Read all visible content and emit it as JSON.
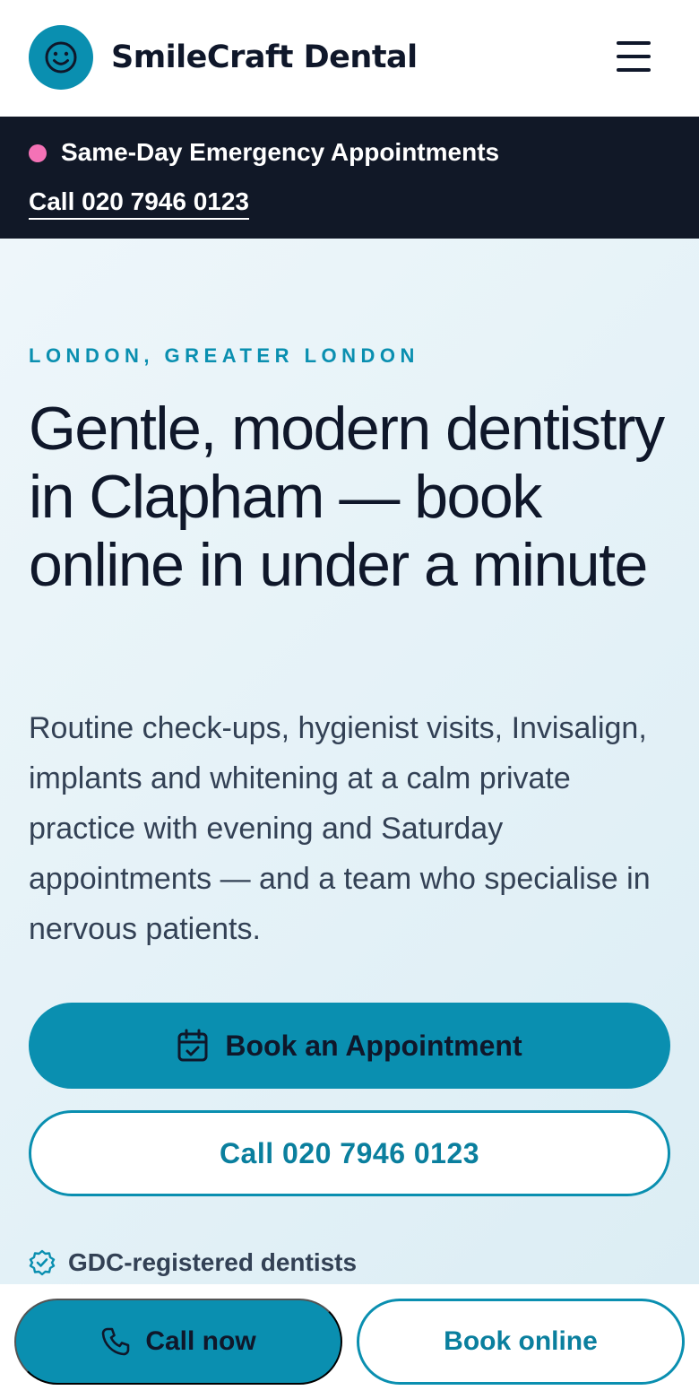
{
  "header": {
    "brand": "SmileCraft Dental",
    "logo_icon": "smiley-face-icon",
    "menu_icon": "hamburger-menu-icon"
  },
  "banner": {
    "title": "Same-Day Emergency Appointments",
    "phone_link": "Call 020 7946 0123",
    "dot_color": "#f472b6"
  },
  "hero": {
    "eyebrow": "LONDON, GREATER LONDON",
    "headline": "Gentle, modern dentistry in Clapham — book online in under a minute",
    "lede": "Routine check-ups, hygienist visits, Invisalign, implants and whitening at a calm private practice with evening and Saturday appointments — and a team who specialise in nervous patients.",
    "primary_cta": "Book an Appointment",
    "primary_cta_icon": "calendar-check-icon",
    "secondary_cta": "Call 020 7946 0123",
    "trust_item": "GDC-registered dentists",
    "trust_icon": "verified-badge-icon"
  },
  "sticky_bar": {
    "call_label": "Call now",
    "call_icon": "phone-icon",
    "book_label": "Book online"
  },
  "colors": {
    "accent": "#0a8fb0",
    "dark": "#111827",
    "text": "#0f172a",
    "muted": "#334155"
  }
}
